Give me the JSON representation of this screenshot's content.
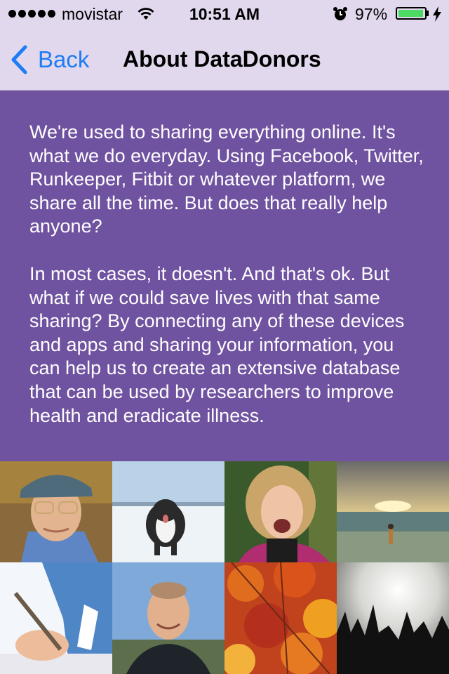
{
  "status_bar": {
    "carrier": "movistar",
    "time": "10:51 AM",
    "battery_percent": "97%",
    "battery_level": 0.97,
    "signal_dots": 5
  },
  "nav": {
    "back_label": "Back",
    "title": "About DataDonors"
  },
  "content": {
    "paragraphs": [
      "We're used to sharing everything online. It's what we do everyday. Using Facebook, Twitter, Runkeeper, Fitbit or whatever platform, we share all the time. But does that really help anyone?",
      "In most cases, it doesn't. And that's ok. But what if we could save lives with that same sharing? By connecting any of these devices and apps and sharing your information, you can help us to create an extensive database that can be used by researchers to improve health and eradicate illness."
    ]
  },
  "photos": [
    {
      "name": "elderly-man-photo"
    },
    {
      "name": "dog-in-snow-photo"
    },
    {
      "name": "laughing-woman-photo"
    },
    {
      "name": "beach-sunset-photo"
    },
    {
      "name": "writing-hand-photo"
    },
    {
      "name": "smiling-man-photo"
    },
    {
      "name": "autumn-leaves-photo"
    },
    {
      "name": "concert-crowd-photo"
    }
  ],
  "colors": {
    "header_bg": "#e2d8ee",
    "content_bg": "#7053a0",
    "back_tint": "#1e7cf5",
    "battery_fill": "#4cd964"
  }
}
